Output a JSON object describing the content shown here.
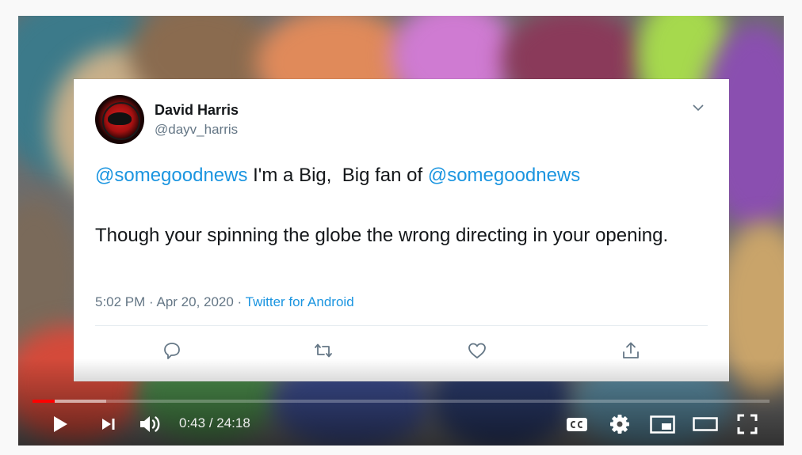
{
  "tweet": {
    "display_name": "David Harris",
    "handle": "@dayv_harris",
    "line1_mention": "@somegoodnews",
    "line1_text": " I'm a Big,  Big fan of ",
    "line1_mention2": "@somegoodnews",
    "line2_text": "Though your spinning the globe the wrong directing in your opening.",
    "timestamp": "5:02 PM · Apr 20, 2020 · ",
    "source": "Twitter for Android",
    "icons": [
      "reply-icon",
      "retweet-icon",
      "like-icon",
      "share-icon",
      "chevron-down-icon"
    ]
  },
  "player": {
    "current_time": "0:43",
    "separator": " / ",
    "duration": "24:18",
    "played_fraction": 0.03,
    "buffered_fraction": 0.1,
    "accent_color": "#ff0000",
    "icons": [
      "play-icon",
      "next-icon",
      "volume-icon",
      "captions-icon",
      "settings-icon",
      "miniplayer-icon",
      "theater-icon",
      "fullscreen-icon"
    ]
  }
}
